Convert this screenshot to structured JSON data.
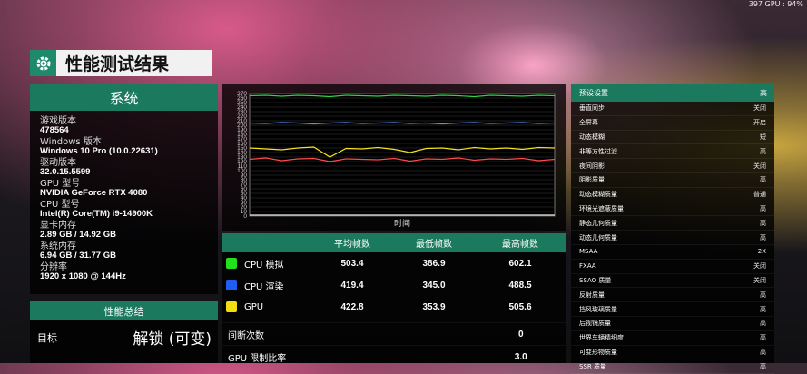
{
  "hud": {
    "overlay": "397 GPU : 94%"
  },
  "title": "性能测试结果",
  "system": {
    "heading": "系统",
    "items": [
      {
        "label": "游戏版本",
        "value": "478564"
      },
      {
        "label": "Windows 版本",
        "value": "Windows 10 Pro (10.0.22631)"
      },
      {
        "label": "驱动版本",
        "value": "32.0.15.5599"
      },
      {
        "label": "GPU 型号",
        "value": "NVIDIA GeForce RTX 4080"
      },
      {
        "label": "CPU 型号",
        "value": "Intel(R) Core(TM) i9-14900K"
      },
      {
        "label": "显卡内存",
        "value": "2.89 GB / 14.92 GB"
      },
      {
        "label": "系统内存",
        "value": "6.94 GB / 31.77 GB"
      },
      {
        "label": "分辨率",
        "value": "1920 x 1080 @ 144Hz"
      }
    ]
  },
  "perf_summary": {
    "heading": "性能总结",
    "target_label": "目标",
    "target_value": "解锁 (可变)"
  },
  "chart_data": {
    "type": "line",
    "xlabel": "时间",
    "ylabel": "",
    "ylim": [
      0,
      270
    ],
    "y_ticks": [
      0,
      10,
      20,
      30,
      40,
      50,
      60,
      70,
      80,
      90,
      100,
      110,
      120,
      130,
      140,
      150,
      160,
      170,
      180,
      190,
      200,
      210,
      220,
      230,
      240,
      250,
      260,
      270
    ],
    "series": [
      {
        "color": "#36d24a",
        "values": [
          265,
          266,
          264,
          266,
          265,
          263,
          266,
          265,
          264,
          266,
          265,
          264,
          266,
          265,
          263,
          266,
          265,
          264,
          266,
          265
        ]
      },
      {
        "color": "#6a8cff",
        "values": [
          205,
          204,
          206,
          205,
          203,
          205,
          206,
          204,
          205,
          206,
          204,
          205,
          203,
          205,
          206,
          204,
          205,
          206,
          204,
          205
        ]
      },
      {
        "color": "#ff4a4a",
        "values": [
          125,
          128,
          122,
          126,
          127,
          120,
          126,
          125,
          124,
          127,
          121,
          126,
          125,
          128,
          123,
          126,
          125,
          127,
          122,
          125
        ]
      },
      {
        "color": "#f5e11c",
        "values": [
          150,
          148,
          146,
          150,
          152,
          130,
          149,
          148,
          151,
          147,
          140,
          149,
          150,
          146,
          151,
          148,
          150,
          147,
          151,
          150
        ]
      },
      {
        "color": "#e8e8e8",
        "values": [
          2,
          2,
          2,
          2,
          2,
          2,
          2,
          2,
          2,
          2,
          2,
          2,
          2,
          2,
          2,
          2,
          2,
          2,
          2,
          2
        ]
      }
    ]
  },
  "fps_table": {
    "headers": [
      "",
      "平均帧数",
      "最低帧数",
      "最高帧数"
    ],
    "rows": [
      {
        "label": "CPU 模拟",
        "color": "#22e01a",
        "avg": "503.4",
        "min": "386.9",
        "max": "602.1"
      },
      {
        "label": "CPU 渲染",
        "color": "#1f5cf0",
        "avg": "419.4",
        "min": "345.0",
        "max": "488.5"
      },
      {
        "label": "GPU",
        "color": "#f2de10",
        "avg": "422.8",
        "min": "353.9",
        "max": "505.6"
      }
    ],
    "stats": [
      {
        "label": "间断次数",
        "value": "0"
      },
      {
        "label": "GPU 限制比率",
        "value": "3.0"
      }
    ]
  },
  "preset": {
    "label": "预设设置",
    "value": "高",
    "rows": [
      {
        "label": "垂直同步",
        "value": "关闭"
      },
      {
        "label": "全屏幕",
        "value": "开启"
      },
      {
        "label": "动态模糊",
        "value": "短"
      },
      {
        "label": "非等方性过滤",
        "value": "高"
      },
      {
        "label": "夜间阴影",
        "value": "关闭"
      },
      {
        "label": "阴影质量",
        "value": "高"
      },
      {
        "label": "动态模糊质量",
        "value": "普通"
      },
      {
        "label": "环境光遮蔽质量",
        "value": "高"
      },
      {
        "label": "静态几何质量",
        "value": "高"
      },
      {
        "label": "动态几何质量",
        "value": "高"
      },
      {
        "label": "MSAA",
        "value": "2X"
      },
      {
        "label": "FXAA",
        "value": "关闭"
      },
      {
        "label": "SSAO 质量",
        "value": "关闭"
      },
      {
        "label": "反射质量",
        "value": "高"
      },
      {
        "label": "挡风玻璃质量",
        "value": "高"
      },
      {
        "label": "后视镜质量",
        "value": "高"
      },
      {
        "label": "世界车辆精细度",
        "value": "高"
      },
      {
        "label": "可变形物质量",
        "value": "高"
      },
      {
        "label": "SSR 质量",
        "value": "高"
      }
    ]
  }
}
